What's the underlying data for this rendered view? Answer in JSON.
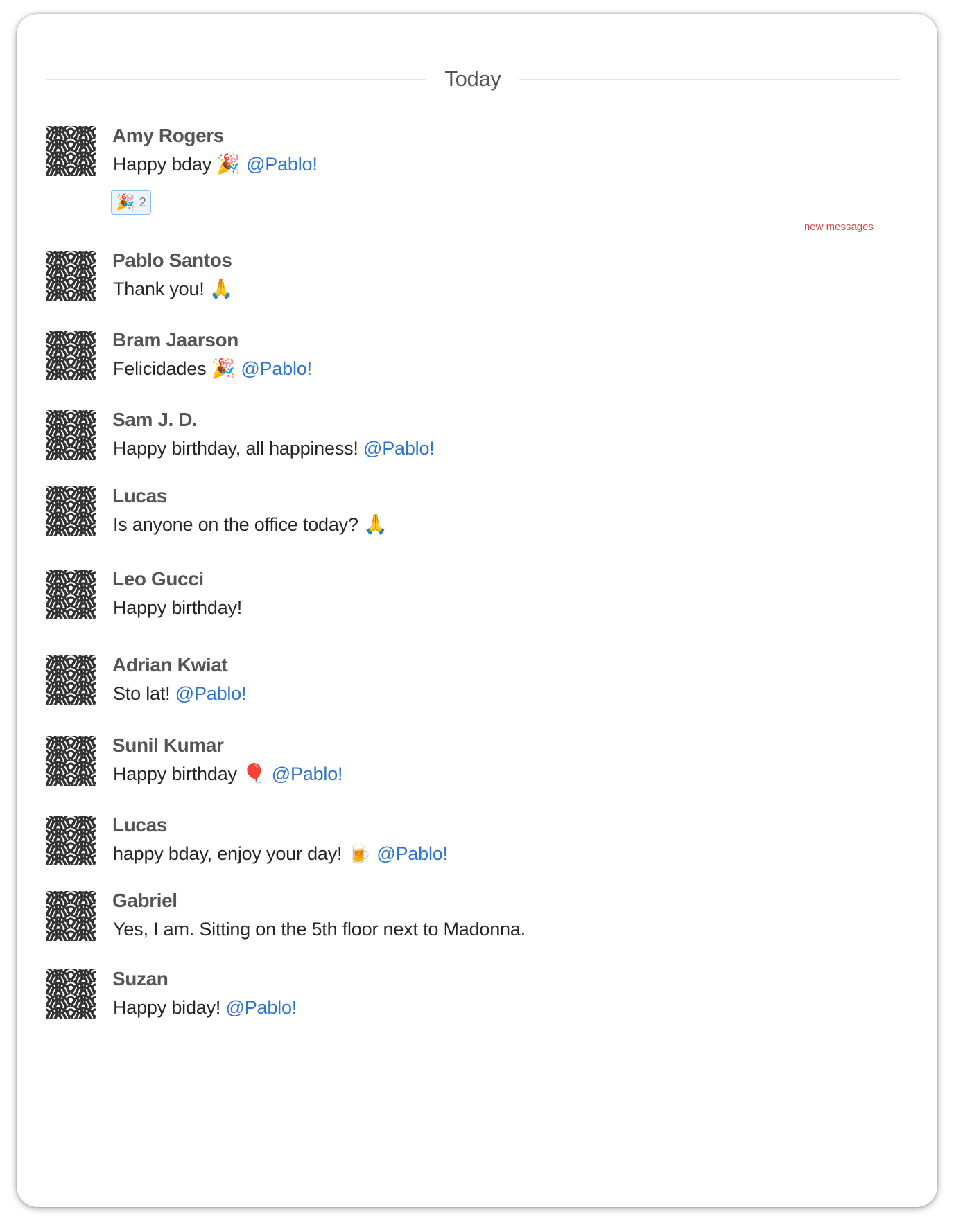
{
  "day_label": "Today",
  "new_messages_label": "new messages",
  "reaction": {
    "emoji": "🎉",
    "count": "2"
  },
  "messages": [
    {
      "author": "Amy Rogers",
      "text": "Happy bday ",
      "emoji": "🎉",
      "mention": "@Pablo!"
    },
    {
      "author": "Pablo Santos",
      "text": "Thank you! ",
      "emoji": "🙏",
      "mention": ""
    },
    {
      "author": "Bram Jaarson",
      "text": "Felicidades ",
      "emoji": "🎉",
      "mention": "@Pablo!"
    },
    {
      "author": "Sam J. D.",
      "text": "Happy birthday, all happiness! ",
      "emoji": "",
      "mention": "@Pablo!"
    },
    {
      "author": "Lucas",
      "text": "Is anyone on the office today? ",
      "emoji": "🙏",
      "mention": ""
    },
    {
      "author": "Leo Gucci",
      "text": "Happy birthday!",
      "emoji": "",
      "mention": ""
    },
    {
      "author": "Adrian Kwiat",
      "text": "Sto lat! ",
      "emoji": "",
      "mention": "@Pablo!"
    },
    {
      "author": "Sunil Kumar",
      "text": "Happy birthday ",
      "emoji": "🎈",
      "mention": "@Pablo!"
    },
    {
      "author": "Lucas",
      "text": "happy bday, enjoy your day! ",
      "emoji": "🍺",
      "mention": "@Pablo!"
    },
    {
      "author": "Gabriel",
      "text": "Yes, I am. Sitting on the 5th floor next to Madonna.",
      "emoji": "",
      "mention": ""
    },
    {
      "author": "Suzan",
      "text": "Happy biday! ",
      "emoji": "",
      "mention": "@Pablo!"
    }
  ],
  "avatar_icon": "seigaiha-wave-pattern-icon",
  "colors": {
    "mention": "#2f74d0",
    "new_divider": "#e0474c",
    "reaction_bg": "#eaf3ff",
    "reaction_border": "#8cbdf3"
  }
}
